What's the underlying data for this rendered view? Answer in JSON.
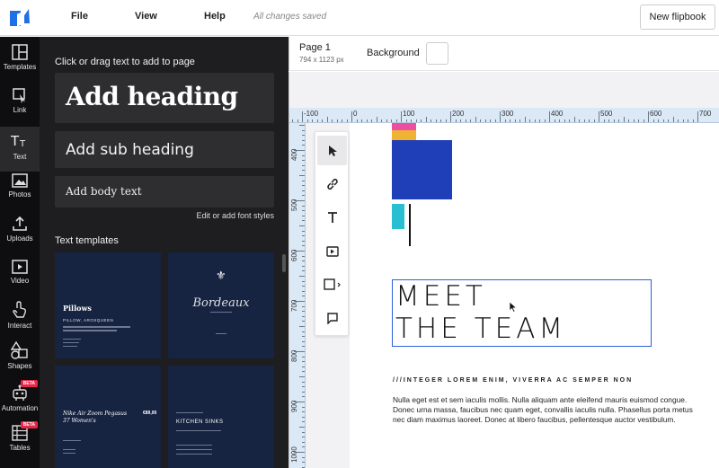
{
  "topbar": {
    "menu": [
      "File",
      "View",
      "Help"
    ],
    "status": "All changes saved",
    "new_flipbook": "New flipbook"
  },
  "rail": [
    {
      "label": "Templates",
      "icon": "templates-icon"
    },
    {
      "label": "Link",
      "icon": "link-icon"
    },
    {
      "label": "Text",
      "icon": "text-icon"
    },
    {
      "label": "Photos",
      "icon": "photos-icon"
    },
    {
      "label": "Uploads",
      "icon": "upload-icon"
    },
    {
      "label": "Video",
      "icon": "video-icon"
    },
    {
      "label": "Interact",
      "icon": "interact-icon"
    },
    {
      "label": "Shapes",
      "icon": "shapes-icon"
    },
    {
      "label": "Automation",
      "icon": "automation-icon",
      "badge": "BETA"
    },
    {
      "label": "Tables",
      "icon": "tables-icon",
      "badge": "BETA"
    }
  ],
  "panel": {
    "title": "Click or drag text to add to page",
    "add_heading": "Add heading",
    "add_subheading": "Add sub heading",
    "add_body": "Add body text",
    "edit_fonts": "Edit or add font styles",
    "templates_title": "Text templates",
    "templates": [
      {
        "title": "Pillows",
        "subtitle": "PILLOW, AROSQUEEN"
      },
      {
        "title": "Bordeaux",
        "subtitle": ""
      },
      {
        "title": "Nike Air Zoom Pegasus\n37 Women's",
        "price": "€89,00"
      },
      {
        "title": "KITCHEN SINKS",
        "subtitle": ""
      }
    ]
  },
  "page": {
    "name": "Page 1",
    "size": "794 x 1123 px",
    "background_label": "Background"
  },
  "ruler": {
    "h_labels": [
      "-100",
      "0",
      "100",
      "200",
      "300",
      "400",
      "500",
      "600",
      "700"
    ],
    "v_labels": [
      "400",
      "500",
      "600",
      "700",
      "800",
      "900",
      "1000"
    ]
  },
  "canvas": {
    "headline_line1": "MEET",
    "headline_line2": "THE TEAM",
    "subcaps": "///INTEGER LOREM ENIM, VIVERRA AC SEMPER NON",
    "body": "Nulla eget est et sem iaculis mollis. Nulla aliquam ante eleifend mauris euismod congue. Donec urna massa, faucibus nec quam eget, convallis iaculis nulla. Phasellus porta metus nec diam maximus laoreet. Donec at libero faucibus, pellentesque auctor vestibulum."
  },
  "colors": {
    "accent_blue": "#2b5fd9",
    "block_blue": "#1f3fb8",
    "yellow": "#f0b233",
    "pink": "#ec4ea3",
    "cyan": "#28bfd3",
    "beta_red": "#e8274b"
  }
}
